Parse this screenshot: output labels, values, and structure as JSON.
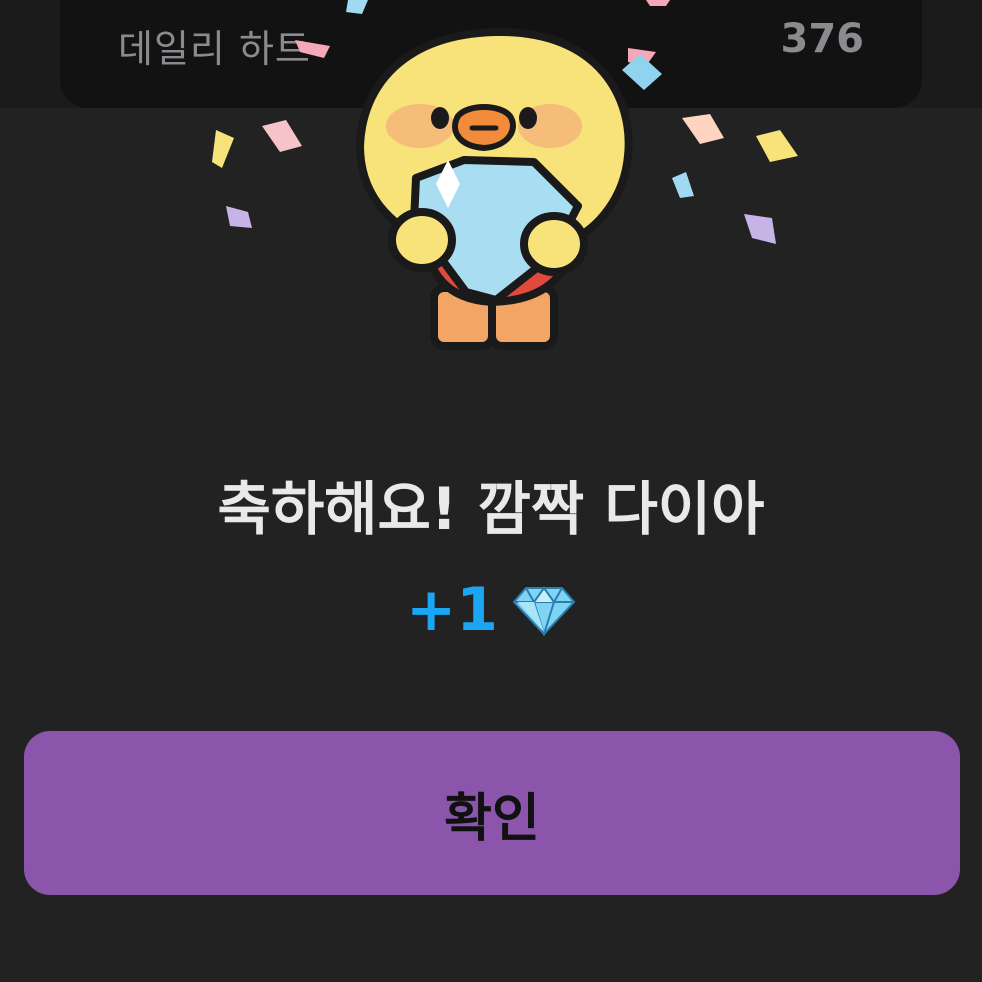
{
  "background_row": {
    "label": "데일리 하트",
    "count": "376"
  },
  "popup": {
    "title": "축하해요! 깜짝 다이아",
    "reward_amount": "+1",
    "reward_icon": "diamond-icon",
    "mascot": "duck-holding-diamond-illustration",
    "confirm_label": "확인"
  },
  "colors": {
    "background": "#222223",
    "accent_button": "#8a55ab",
    "reward_text": "#1aa6f2",
    "title_text": "#e9e9ea"
  }
}
